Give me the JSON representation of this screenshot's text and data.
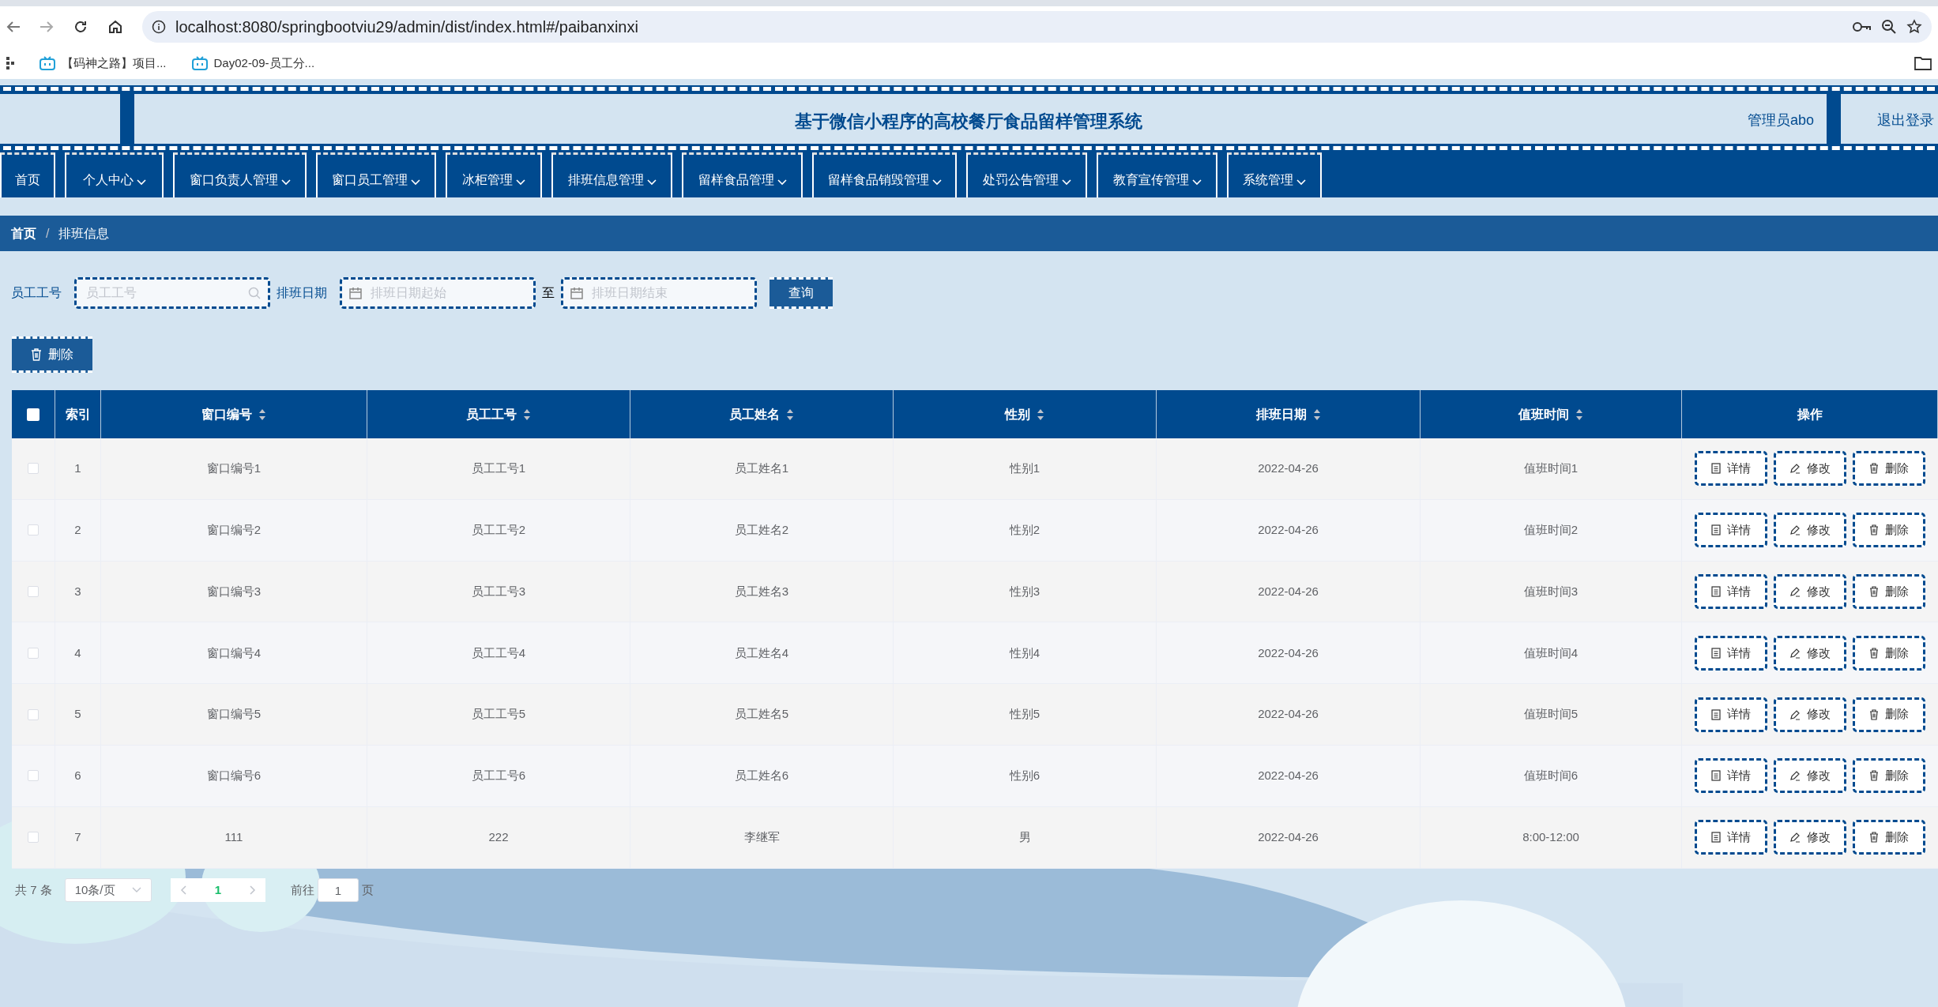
{
  "browser": {
    "url": "localhost:8080/springbootviu29/admin/dist/index.html#/paibanxinxi",
    "bookmarks": [
      "【码神之路】项目...",
      "Day02-09-员工分..."
    ]
  },
  "header": {
    "title": "基于微信小程序的高校餐厅食品留样管理系统",
    "user": "管理员abo",
    "logout": "退出登录"
  },
  "nav": [
    {
      "label": "首页",
      "dropdown": false
    },
    {
      "label": "个人中心",
      "dropdown": true
    },
    {
      "label": "窗口负责人管理",
      "dropdown": true
    },
    {
      "label": "窗口员工管理",
      "dropdown": true
    },
    {
      "label": "冰柜管理",
      "dropdown": true
    },
    {
      "label": "排班信息管理",
      "dropdown": true
    },
    {
      "label": "留样食品管理",
      "dropdown": true
    },
    {
      "label": "留样食品销毁管理",
      "dropdown": true
    },
    {
      "label": "处罚公告管理",
      "dropdown": true
    },
    {
      "label": "教育宣传管理",
      "dropdown": true
    },
    {
      "label": "系统管理",
      "dropdown": true
    }
  ],
  "breadcrumb": {
    "items": [
      "首页",
      "排班信息"
    ],
    "separator": "/"
  },
  "search": {
    "fields": [
      {
        "label": "员工工号",
        "placeholder": "员工工号",
        "kind": "text"
      },
      {
        "label": "排班日期",
        "placeholder": "排班日期起始",
        "kind": "date"
      },
      {
        "label": "至",
        "placeholder": "排班日期结束",
        "kind": "date"
      }
    ],
    "button": "查询"
  },
  "actions": [
    "删除"
  ],
  "table": {
    "select_all": {
      "checked": false
    },
    "columns": [
      {
        "label": "索引",
        "sortable": false
      },
      {
        "label": "窗口编号",
        "sortable": true
      },
      {
        "label": "员工工号",
        "sortable": true
      },
      {
        "label": "员工姓名",
        "sortable": true
      },
      {
        "label": "性别",
        "sortable": true
      },
      {
        "label": "排班日期",
        "sortable": true
      },
      {
        "label": "值班时间",
        "sortable": true
      },
      {
        "label": "操作",
        "sortable": false
      }
    ],
    "rows": [
      {
        "checked": false,
        "cells": [
          "1",
          "窗口编号1",
          "员工工号1",
          "员工姓名1",
          "性别1",
          "2022-04-26",
          "值班时间1"
        ],
        "actions": [
          {
            "label": "详情",
            "kind": "detail"
          },
          {
            "label": "修改",
            "kind": "edit"
          },
          {
            "label": "删除",
            "kind": "delete"
          }
        ]
      },
      {
        "checked": false,
        "cells": [
          "2",
          "窗口编号2",
          "员工工号2",
          "员工姓名2",
          "性别2",
          "2022-04-26",
          "值班时间2"
        ],
        "actions": [
          {
            "label": "详情",
            "kind": "detail"
          },
          {
            "label": "修改",
            "kind": "edit"
          },
          {
            "label": "删除",
            "kind": "delete"
          }
        ]
      },
      {
        "checked": false,
        "cells": [
          "3",
          "窗口编号3",
          "员工工号3",
          "员工姓名3",
          "性别3",
          "2022-04-26",
          "值班时间3"
        ],
        "actions": [
          {
            "label": "详情",
            "kind": "detail"
          },
          {
            "label": "修改",
            "kind": "edit"
          },
          {
            "label": "删除",
            "kind": "delete"
          }
        ]
      },
      {
        "checked": false,
        "cells": [
          "4",
          "窗口编号4",
          "员工工号4",
          "员工姓名4",
          "性别4",
          "2022-04-26",
          "值班时间4"
        ],
        "actions": [
          {
            "label": "详情",
            "kind": "detail"
          },
          {
            "label": "修改",
            "kind": "edit"
          },
          {
            "label": "删除",
            "kind": "delete"
          }
        ]
      },
      {
        "checked": false,
        "cells": [
          "5",
          "窗口编号5",
          "员工工号5",
          "员工姓名5",
          "性别5",
          "2022-04-26",
          "值班时间5"
        ],
        "actions": [
          {
            "label": "详情",
            "kind": "detail"
          },
          {
            "label": "修改",
            "kind": "edit"
          },
          {
            "label": "删除",
            "kind": "delete"
          }
        ]
      },
      {
        "checked": false,
        "cells": [
          "6",
          "窗口编号6",
          "员工工号6",
          "员工姓名6",
          "性别6",
          "2022-04-26",
          "值班时间6"
        ],
        "actions": [
          {
            "label": "详情",
            "kind": "detail"
          },
          {
            "label": "修改",
            "kind": "edit"
          },
          {
            "label": "删除",
            "kind": "delete"
          }
        ]
      },
      {
        "checked": false,
        "cells": [
          "7",
          "111",
          "222",
          "李继军",
          "男",
          "2022-04-26",
          "8:00-12:00"
        ],
        "actions": [
          {
            "label": "详情",
            "kind": "detail"
          },
          {
            "label": "修改",
            "kind": "edit"
          },
          {
            "label": "删除",
            "kind": "delete"
          }
        ]
      }
    ]
  },
  "pagination": {
    "total": "共 7 条",
    "page_size": "10条/页",
    "pages": [
      {
        "label": "1",
        "selected": true
      }
    ],
    "goto_label": "前往",
    "goto_value": "1",
    "goto_suffix": "页"
  }
}
